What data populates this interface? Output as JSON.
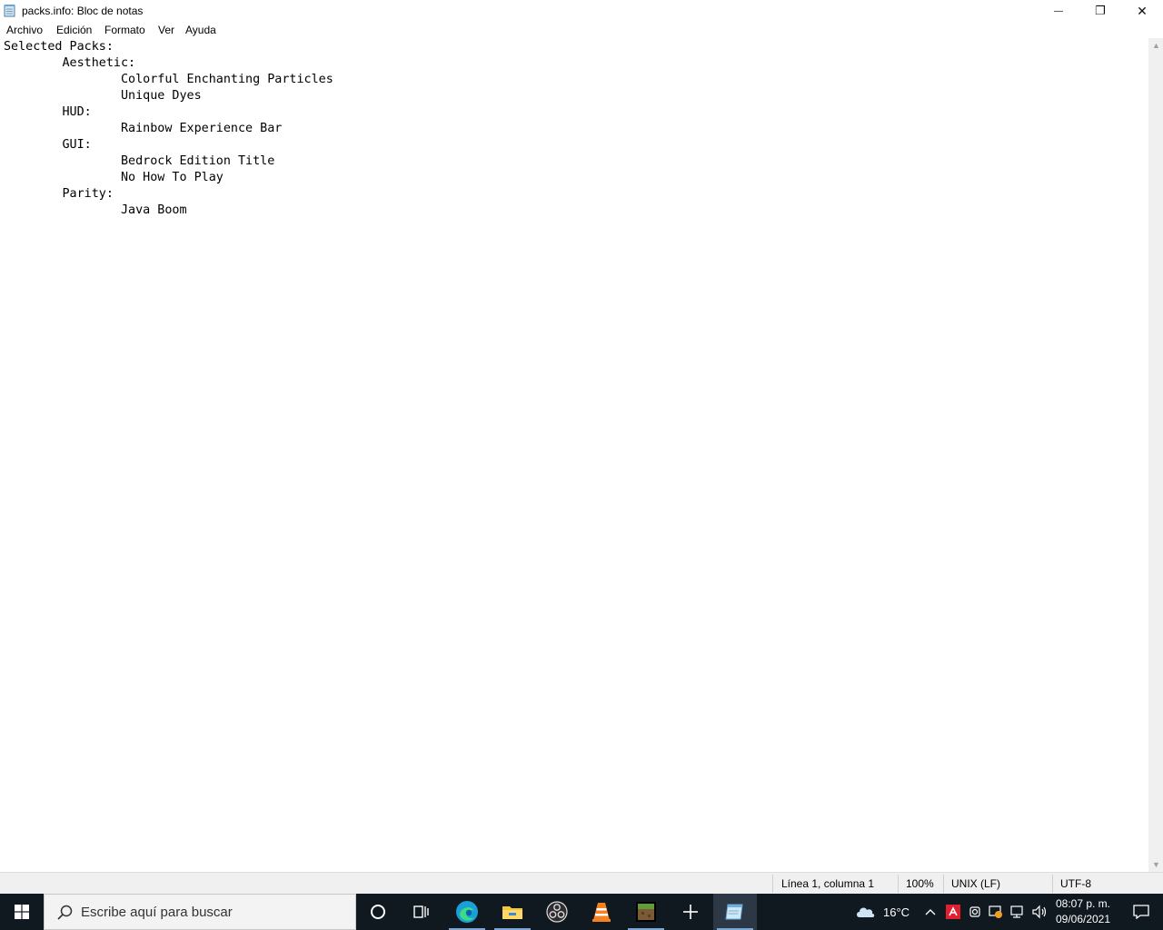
{
  "window": {
    "title": "packs.info: Bloc de notas",
    "minimize_glyph": "—",
    "maximize_glyph": "❐",
    "close_glyph": "✕"
  },
  "menu": [
    "Archivo",
    "Edición",
    "Formato",
    "Ver",
    "Ayuda"
  ],
  "editor": {
    "lines": [
      "Selected Packs:",
      "        Aesthetic:",
      "                Colorful Enchanting Particles",
      "                Unique Dyes",
      "        HUD:",
      "                Rainbow Experience Bar",
      "        GUI:",
      "                Bedrock Edition Title",
      "                No How To Play",
      "        Parity:",
      "                Java Boom"
    ]
  },
  "statusbar": {
    "position": "Línea 1, columna 1",
    "zoom": "100%",
    "line_ending": "UNIX (LF)",
    "encoding": "UTF-8"
  },
  "taskbar": {
    "search_placeholder": "Escribe aquí para buscar",
    "apps": [
      "cortana-icon",
      "task-view-icon",
      "edge-icon",
      "file-explorer-icon",
      "obs-icon",
      "vlc-icon",
      "minecraft-icon",
      "add-icon",
      "notepad-icon"
    ],
    "weather_temp": "16°C",
    "clock_time": "08:07 p. m.",
    "clock_date": "09/06/2021"
  },
  "colors": {
    "taskbar_bg": "#101820",
    "statusbar_bg": "#f0f0f0",
    "accent": "#7aa7d6"
  }
}
